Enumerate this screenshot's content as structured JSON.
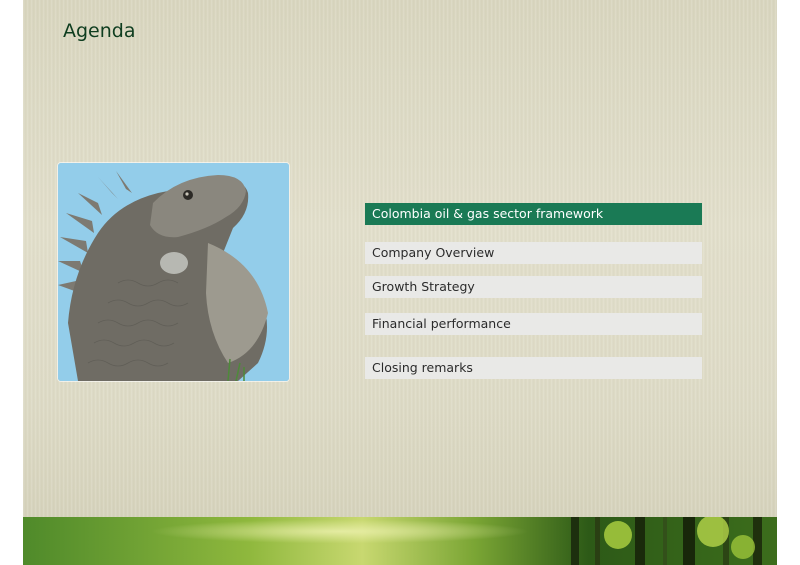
{
  "slide": {
    "title": "Agenda"
  },
  "agenda": {
    "items": [
      {
        "label": "Colombia oil & gas sector framework",
        "active": true
      },
      {
        "label": "Company Overview",
        "active": false
      },
      {
        "label": "Growth Strategy",
        "active": false
      },
      {
        "label": "Financial performance",
        "active": false
      },
      {
        "label": "Closing remarks",
        "active": false
      }
    ]
  },
  "colors": {
    "accent": "#1a7a55",
    "title": "#0e3d1f",
    "item_background": "#e9e9e7",
    "slide_background": "#dcd9c3"
  },
  "images": {
    "photo": "iguana-photo",
    "footer": "green-forest-banner"
  }
}
